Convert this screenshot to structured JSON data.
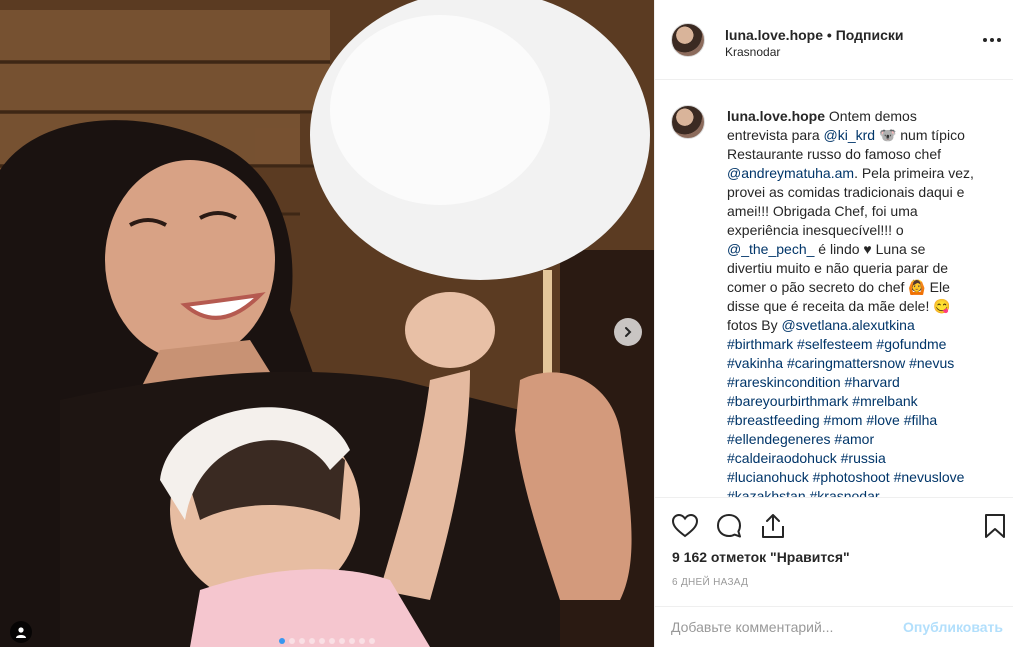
{
  "post": {
    "username": "luna.love.hope",
    "separator": " • ",
    "follow_label": "Подписки",
    "location": "Krasnodar",
    "more_icon": "more-horizontal-icon"
  },
  "caption": {
    "owner": "luna.love.hope",
    "t1": " Ontem demos\nentrevista para ",
    "m1": "@ki_krd",
    "t2": " 🐨 num típico\nRestaurante russo do famoso chef\n",
    "m2": "@andreymatuha.am",
    "t3": ". Pela primeira vez,\nprovei as comidas tradicionais daqui e\namei!!! Obrigada Chef, foi uma\nexperiência inesquecível!!! o\n",
    "m3": "@_the_pech_",
    "t4": " é lindo ♥ Luna se\ndivertiu muito e não queria parar de\ncomer o pão secreto do chef 🙆 Ele\ndisse que é receita da mãe dele! 😋\nfotos By ",
    "m4": "@svetlana.alexutkina",
    "tags": [
      "#birthmark",
      "#selfesteem",
      "#gofundme",
      "#vakinha",
      "#caringmattersnow",
      "#nevus",
      "#rareskincondition",
      "#harvard",
      "#bareyourbirthmark",
      "#mrelbank",
      "#breastfeeding",
      "#mom",
      "#love",
      "#filha",
      "#ellendegeneres",
      "#amor",
      "#caldeiraodohuck",
      "#russia",
      "#lucianohuck",
      "#photoshoot",
      "#nevuslove",
      "#kazakhstan",
      "#krasnodar"
    ]
  },
  "actions": {
    "like_icon": "heart-icon",
    "comment_icon": "comment-icon",
    "share_icon": "share-icon",
    "save_icon": "bookmark-icon"
  },
  "likes_text": "9 162 отметок \"Нравится\"",
  "time_ago": "6 дней назад",
  "comment_box": {
    "placeholder": "Добавьте комментарий...",
    "post_label": "Опубликовать"
  },
  "carousel": {
    "total": 10,
    "current": 1,
    "next_icon": "chevron-right-icon",
    "tag_icon": "user-tag-icon"
  },
  "colors": {
    "link": "#003569",
    "hashtag": "#003569",
    "post_disabled": "#b2dffc",
    "active_dot": "#3897f0"
  }
}
